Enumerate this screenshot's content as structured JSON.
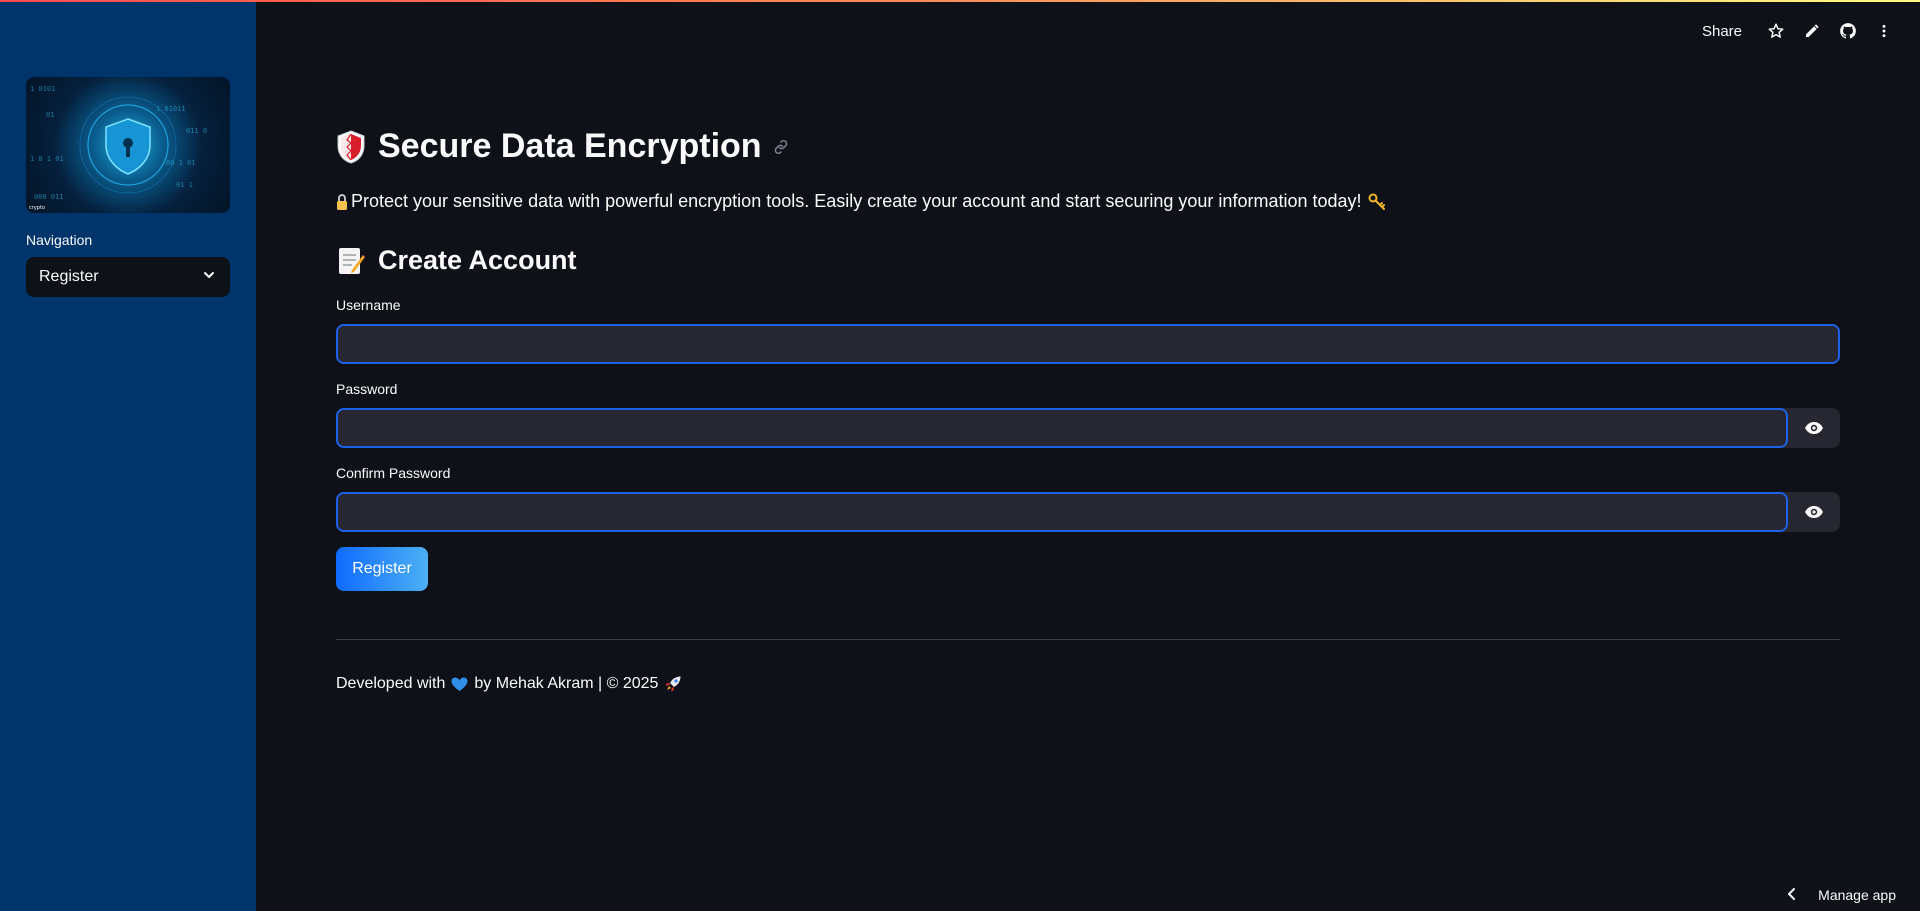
{
  "header": {
    "share_label": "Share",
    "icons": [
      "star-icon",
      "pencil-icon",
      "github-icon",
      "more-vertical-icon"
    ]
  },
  "sidebar": {
    "image_caption": "crypto",
    "navigation_label": "Navigation",
    "navigation_selected": "Register"
  },
  "main": {
    "title": "Secure Data Encryption",
    "subtitle": "Protect your sensitive data with powerful encryption tools. Easily create your account and start securing your information today!",
    "section_title": "Create Account",
    "fields": {
      "username_label": "Username",
      "username_value": "",
      "password_label": "Password",
      "password_value": "",
      "confirm_label": "Confirm Password",
      "confirm_value": ""
    },
    "register_button": "Register",
    "footer_prefix": "Developed with",
    "footer_suffix": "by Mehak Akram | © 2025"
  },
  "manage_app_label": "Manage app",
  "colors": {
    "sidebar_bg": "#00356b",
    "main_bg": "#0e1117",
    "input_border": "#1c61e6",
    "button_gradient_start": "#0f6bff",
    "button_gradient_end": "#4db0f5"
  }
}
